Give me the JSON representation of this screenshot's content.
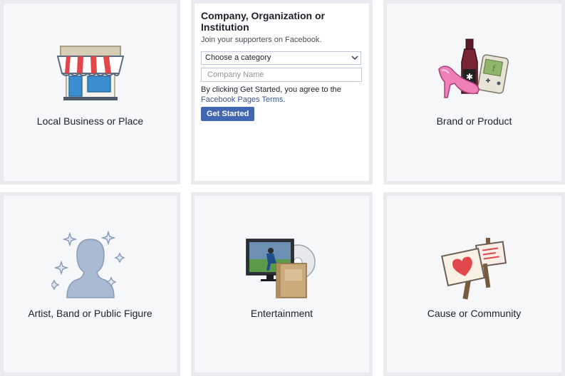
{
  "tiles": {
    "local_business": {
      "label": "Local Business or Place",
      "icon": "storefront-icon"
    },
    "company": {
      "title": "Company, Organization or Institution",
      "subtitle": "Join your supporters on Facebook.",
      "category_select": {
        "selected": "Choose a category"
      },
      "name_input": {
        "placeholder": "Company Name",
        "value": ""
      },
      "terms_prefix": "By clicking Get Started, you agree to the",
      "terms_link": "Facebook Pages Terms",
      "terms_suffix": ".",
      "button_label": "Get Started"
    },
    "brand": {
      "label": "Brand or Product",
      "icon": "brand-products-icon"
    },
    "artist": {
      "label": "Artist, Band or Public Figure",
      "icon": "public-figure-silhouette-icon"
    },
    "entertainment": {
      "label": "Entertainment",
      "icon": "tv-book-disc-icon"
    },
    "cause": {
      "label": "Cause or Community",
      "icon": "protest-signs-icon"
    }
  },
  "colors": {
    "tile_border": "#e9ebee",
    "tile_background": "#f6f7f9",
    "link": "#365899",
    "button": "#4267b2"
  }
}
